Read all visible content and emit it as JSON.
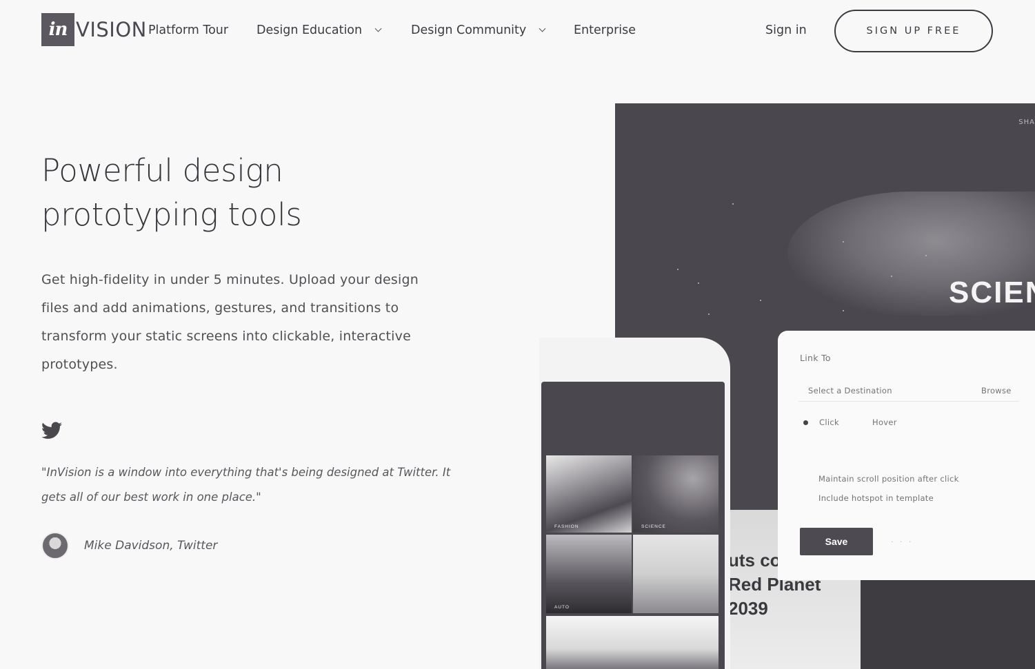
{
  "nav": {
    "logo_mark": "in",
    "logo_word": "VISION",
    "links": [
      {
        "label": "Platform Tour",
        "has_menu": false
      },
      {
        "label": "Design Education",
        "has_menu": true
      },
      {
        "label": "Design Community",
        "has_menu": true
      },
      {
        "label": "Enterprise",
        "has_menu": false
      }
    ],
    "sign_in": "Sign in",
    "sign_up": "SIGN UP FREE"
  },
  "hero": {
    "headline_line1": "Powerful design",
    "headline_line2": "prototyping tools",
    "lead": "Get high-fidelity in under 5 minutes. Upload your design files and add animations, gestures, and transitions to transform your static screens into clickable, interactive prototypes."
  },
  "testimonial": {
    "icon": "twitter-icon",
    "quote": "\"InVision is a window into everything that's being designed at Twitter. It gets all of our best work in one place.\"",
    "author": "Mike Davidson, Twitter"
  },
  "mockup": {
    "desktop_heading": "SCIEN",
    "desktop_top_text": "SHA",
    "article_lines": [
      "uts co",
      "Red Planet",
      "2039"
    ],
    "panel": {
      "title": "Link To",
      "destination_placeholder": "Select a Destination",
      "browse": "Browse",
      "trigger_click": "Click",
      "trigger_hover": "Hover",
      "option_scroll": "Maintain scroll position after click",
      "option_template": "Include hotspot in template",
      "save": "Save",
      "cancel": "· · ·"
    },
    "phone_tiles": [
      "FASHION",
      "SCIENCE",
      "AUTO",
      ""
    ]
  },
  "colors": {
    "background": "#f8f8f8",
    "text_dark": "#3a3a3a",
    "mockup_dark": "#4b474e"
  }
}
